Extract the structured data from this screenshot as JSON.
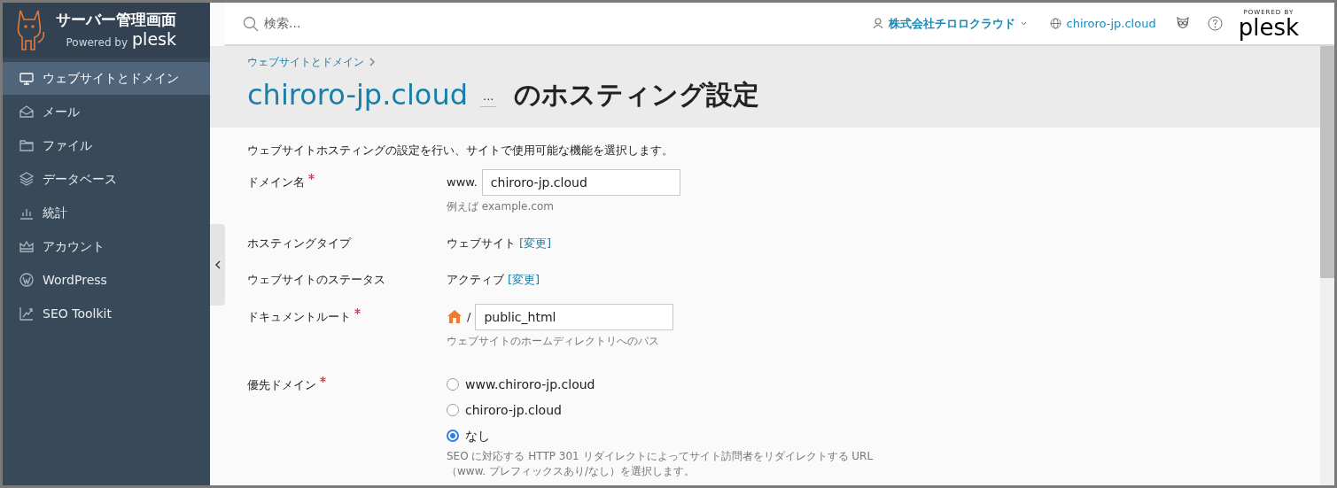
{
  "sidebar": {
    "brand": {
      "title": "サーバー管理画面",
      "powered_by": "Powered by",
      "product": "plesk"
    },
    "items": [
      {
        "label": "ウェブサイトとドメイン",
        "selected": true
      },
      {
        "label": "メール",
        "selected": false
      },
      {
        "label": "ファイル",
        "selected": false
      },
      {
        "label": "データベース",
        "selected": false
      },
      {
        "label": "統計",
        "selected": false
      },
      {
        "label": "アカウント",
        "selected": false
      },
      {
        "label": "WordPress",
        "selected": false
      },
      {
        "label": "SEO Toolkit",
        "selected": false
      }
    ]
  },
  "header": {
    "search": {
      "placeholder": "検索..."
    },
    "account": "株式会社チロロクラウド",
    "site": "chiroro-jp.cloud",
    "powered_by": "POWERED BY",
    "product": "plesk"
  },
  "breadcrumb": [
    "ウェブサイトとドメイン"
  ],
  "title": {
    "domain": "chiroro-jp.cloud",
    "more": "...",
    "text": "のホスティング設定"
  },
  "intro": "ウェブサイトホスティングの設定を行い、サイトで使用可能な機能を選択します。",
  "form": [
    {
      "kind": "input",
      "label": "ドメイン名",
      "required": true,
      "prefix": "www.",
      "value": "chiroro-jp.cloud",
      "hint": "例えば example.com"
    },
    {
      "kind": "value",
      "label": "ホスティングタイプ",
      "required": false,
      "value": "ウェブサイト",
      "link": "[変更]"
    },
    {
      "kind": "value",
      "label": "ウェブサイトのステータス",
      "required": false,
      "value": "アクティブ",
      "link": "[変更]"
    },
    {
      "kind": "path",
      "label": "ドキュメントルート",
      "required": true,
      "prefix": "/",
      "value": "public_html",
      "hint": "ウェブサイトのホームディレクトリへのパス"
    },
    {
      "kind": "radio",
      "label": "優先ドメイン",
      "required": true,
      "options": [
        {
          "label": "www.chiroro-jp.cloud",
          "selected": false
        },
        {
          "label": "chiroro-jp.cloud",
          "selected": false
        },
        {
          "label": "なし",
          "selected": true
        }
      ],
      "hint": "SEO に対応する HTTP 301 リダイレクトによってサイト訪問者をリダイレクトする URL\n（www. プレフィックスあり/なし）を選択します。"
    }
  ]
}
